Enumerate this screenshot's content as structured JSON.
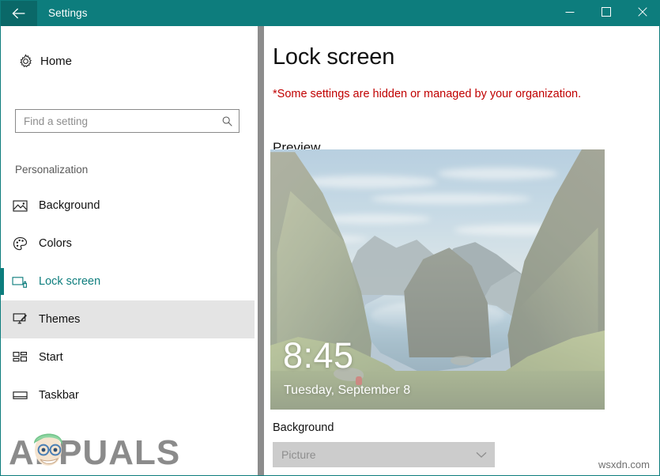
{
  "window": {
    "title": "Settings",
    "back_icon": "back-arrow-icon",
    "minimize_label": "Minimize",
    "maximize_label": "Maximize",
    "close_label": "Close",
    "accent_color": "#0d7d7d",
    "back_button_color": "#0a6868"
  },
  "sidebar": {
    "home": {
      "label": "Home",
      "icon": "gear-icon"
    },
    "search": {
      "value": "",
      "placeholder": "Find a setting",
      "icon": "search-icon"
    },
    "category": "Personalization",
    "items": [
      {
        "label": "Background",
        "icon": "picture-icon",
        "state": "normal"
      },
      {
        "label": "Colors",
        "icon": "palette-icon",
        "state": "normal"
      },
      {
        "label": "Lock screen",
        "icon": "lock-screen-icon",
        "state": "active"
      },
      {
        "label": "Themes",
        "icon": "themes-brush-icon",
        "state": "hovered"
      },
      {
        "label": "Start",
        "icon": "start-tiles-icon",
        "state": "normal"
      },
      {
        "label": "Taskbar",
        "icon": "taskbar-icon",
        "state": "normal"
      }
    ],
    "active_color": "#0d7d7d",
    "hover_color": "#e4e4e4"
  },
  "main": {
    "page_title": "Lock screen",
    "warning": "*Some settings are hidden or managed by your organization.",
    "warning_color": "#c00000",
    "preview_heading": "Preview",
    "preview": {
      "clock": "8:45",
      "date": "Tuesday, September 8",
      "scene": "fjord-mountain-lake-landscape"
    },
    "background_setting": {
      "label": "Background",
      "value": "Picture",
      "disabled": true,
      "chevron_icon": "chevron-down-icon"
    }
  },
  "watermarks": {
    "logo_text": "APPUALS",
    "site": "wsxdn.com"
  }
}
